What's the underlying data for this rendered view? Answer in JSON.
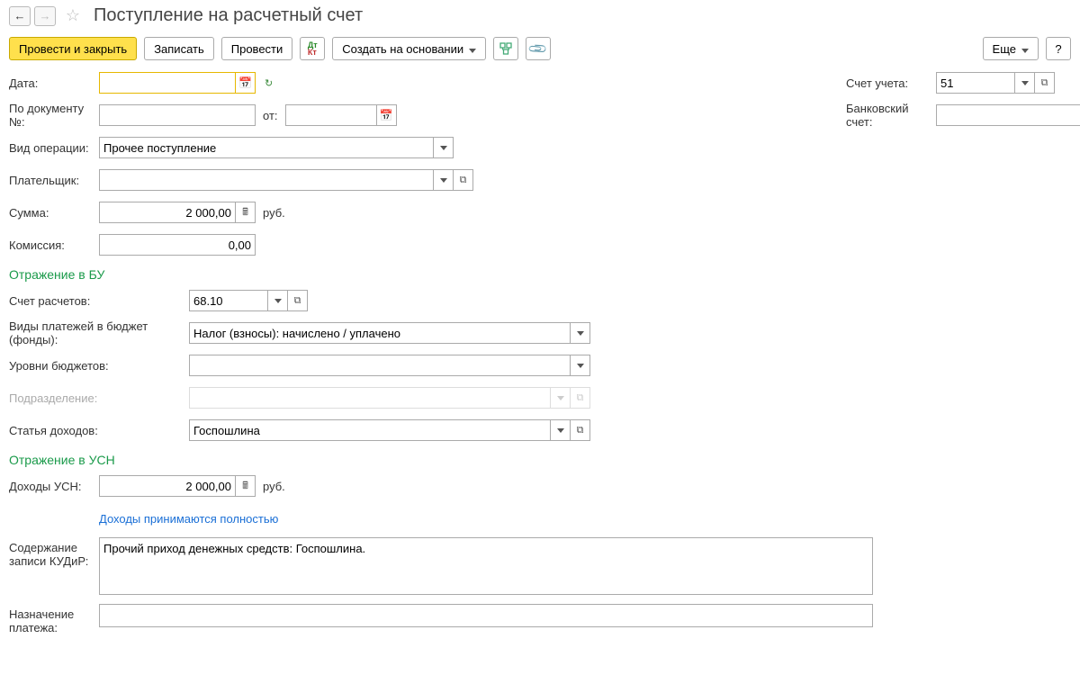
{
  "header": {
    "title": "Поступление на расчетный счет"
  },
  "toolbar": {
    "post_close": "Провести и закрыть",
    "save": "Записать",
    "post": "Провести",
    "create_based": "Создать на основании",
    "more": "Еще",
    "help": "?"
  },
  "labels": {
    "date": "Дата:",
    "account": "Счет учета:",
    "doc_num": "По документу №:",
    "from": "от:",
    "bank_account": "Банковский счет:",
    "op_type": "Вид операции:",
    "payer": "Плательщик:",
    "sum": "Сумма:",
    "commission": "Комиссия:",
    "section_bu": "Отражение в БУ",
    "settlement_account": "Счет расчетов:",
    "budget_payment_types": "Виды платежей в бюджет (фонды):",
    "budget_levels": "Уровни бюджетов:",
    "division": "Подразделение:",
    "income_article": "Статья доходов:",
    "section_usn": "Отражение в УСН",
    "usn_income": "Доходы УСН:",
    "income_full": "Доходы принимаются полностью",
    "kudir_content": "Содержание записи КУДиР:",
    "purpose": "Назначение платежа:",
    "rub": "руб."
  },
  "values": {
    "date": "",
    "account": "51",
    "doc_num": "",
    "doc_date": "",
    "bank_account": "",
    "op_type": "Прочее поступление",
    "payer": "",
    "sum": "2 000,00",
    "commission": "0,00",
    "settlement_account": "68.10",
    "budget_payment_types": "Налог (взносы): начислено / уплачено",
    "budget_levels": "",
    "division": "",
    "income_article": "Госпошлина",
    "usn_income": "2 000,00",
    "kudir_content": "Прочий приход денежных средств: Госпошлина.",
    "purpose": ""
  }
}
